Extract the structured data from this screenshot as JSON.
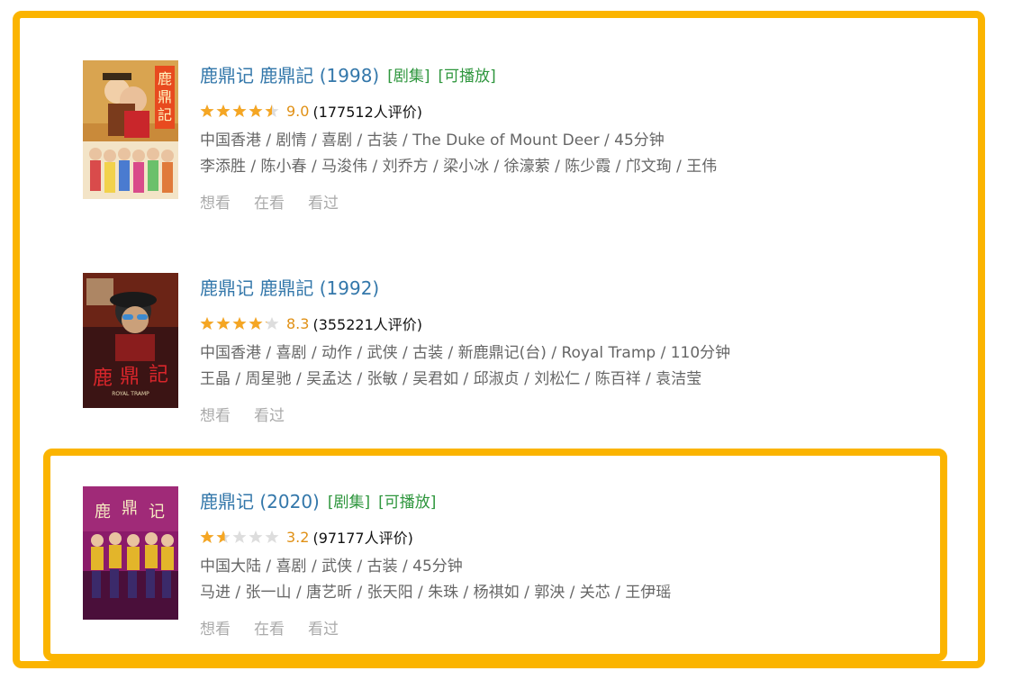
{
  "results": [
    {
      "title": "鹿鼎记 鹿鼎記 (1998)",
      "tags": [
        "[剧集]",
        "[可播放]"
      ],
      "rating": 9.0,
      "score": "9.0",
      "votes": "(177512人评价)",
      "meta": "中国香港 / 剧情 / 喜剧 / 古装 / The Duke of Mount Deer / 45分钟",
      "cast": "李添胜 / 陈小春 / 马浚伟 / 刘乔方 / 梁小冰 / 徐濠萦 / 陈少霞 / 邝文珣 / 王伟",
      "actions": [
        "想看",
        "在看",
        "看过"
      ],
      "poster": {
        "title_glyphs": "鹿鼎記"
      }
    },
    {
      "title": "鹿鼎记 鹿鼎記 (1992)",
      "tags": [],
      "rating": 8.3,
      "score": "8.3",
      "votes": "(355221人评价)",
      "meta": "中国香港 / 喜剧 / 动作 / 武侠 / 古装 / 新鹿鼎记(台) / Royal Tramp / 110分钟",
      "cast": "王晶 / 周星驰 / 吴孟达 / 张敏 / 吴君如 / 邱淑贞 / 刘松仁 / 陈百祥 / 袁洁莹",
      "actions": [
        "想看",
        "看过"
      ],
      "poster": {
        "title_glyphs": "鹿鼎記",
        "subtitle": "ROYAL TRAMP"
      }
    },
    {
      "title": "鹿鼎记 (2020)",
      "tags": [
        "[剧集]",
        "[可播放]"
      ],
      "rating": 3.2,
      "score": "3.2",
      "votes": "(97177人评价)",
      "meta": "中国大陆 / 喜剧 / 武侠 / 古装 / 45分钟",
      "cast": "马进 / 张一山 / 唐艺昕 / 张天阳 / 朱珠 / 杨祺如 / 郭泱 / 关芯 / 王伊瑶",
      "actions": [
        "想看",
        "在看",
        "看过"
      ],
      "poster": {
        "title_glyphs": "鹿鼎记"
      }
    }
  ],
  "colors": {
    "title_link": "#3377aa",
    "tag_green": "#2e963d",
    "score_orange": "#e09015",
    "star_filled": "#f5a623",
    "star_empty": "#dddddd",
    "meta_gray": "#666666",
    "action_gray": "#aaaaaa",
    "highlight_frame": "#fbb400"
  }
}
